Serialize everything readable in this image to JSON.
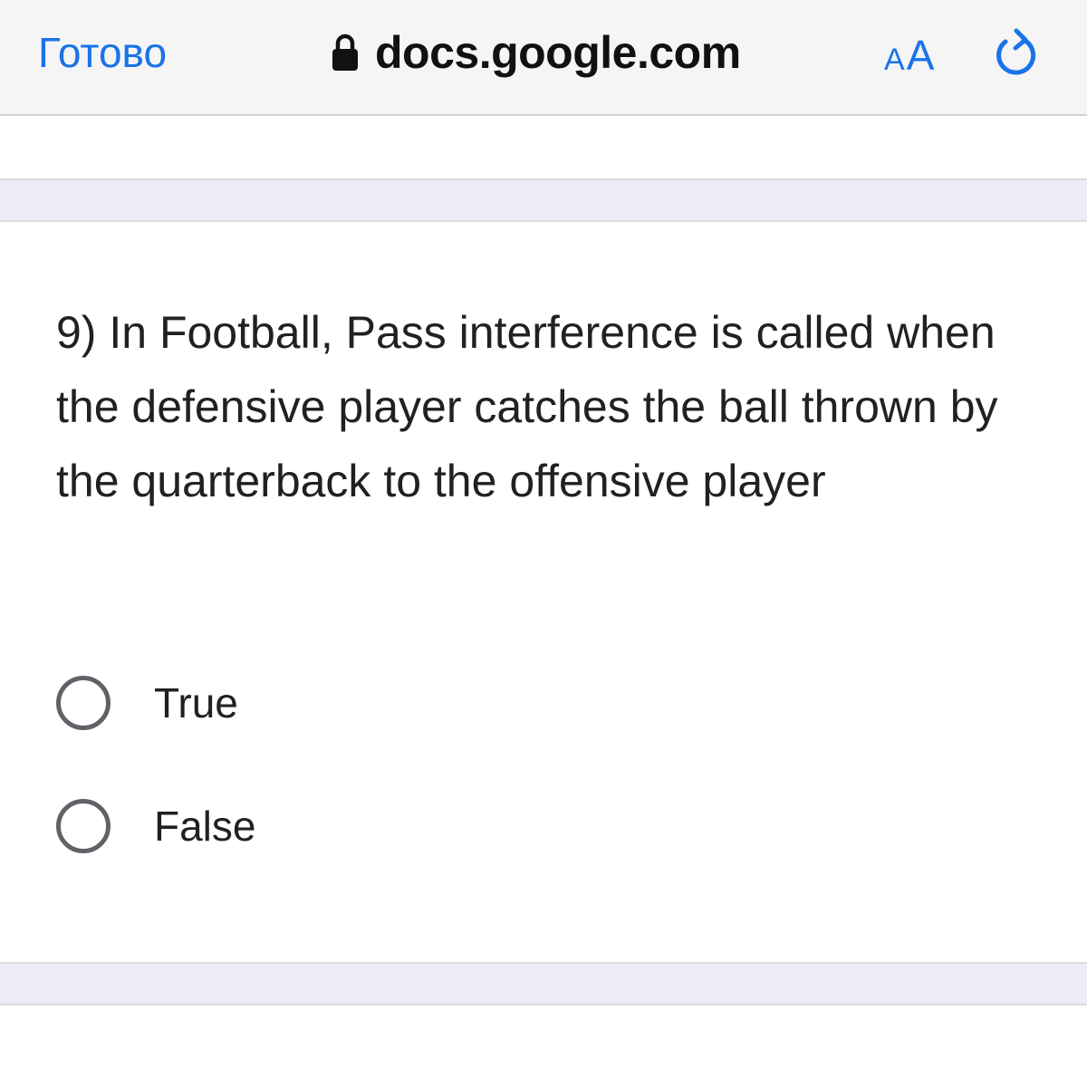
{
  "browser": {
    "done_label": "Готово",
    "url": "docs.google.com",
    "text_size_small": "A",
    "text_size_big": "A"
  },
  "question": {
    "text": "9) In Football, Pass interference is called when the defensive player catches the ball thrown by the quarterback to the offensive player",
    "options": [
      {
        "label": "True",
        "selected": false
      },
      {
        "label": "False",
        "selected": false
      }
    ]
  },
  "colors": {
    "accent": "#1a73e8",
    "band": "#eeebf6",
    "radio_border": "#5f6368",
    "text": "#202124"
  }
}
